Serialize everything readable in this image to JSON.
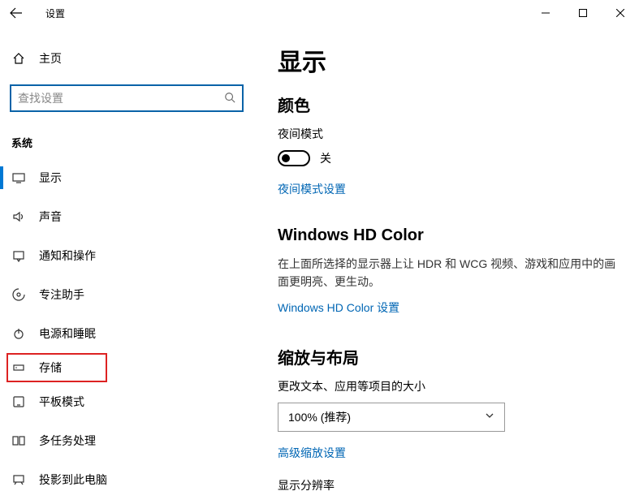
{
  "titlebar": {
    "title": "设置"
  },
  "sidebar": {
    "home": "主页",
    "search_placeholder": "查找设置",
    "section_label": "系统",
    "items": [
      {
        "label": "显示"
      },
      {
        "label": "声音"
      },
      {
        "label": "通知和操作"
      },
      {
        "label": "专注助手"
      },
      {
        "label": "电源和睡眠"
      },
      {
        "label": "存储"
      },
      {
        "label": "平板模式"
      },
      {
        "label": "多任务处理"
      },
      {
        "label": "投影到此电脑"
      }
    ]
  },
  "content": {
    "heading": "显示",
    "color_heading": "颜色",
    "night_mode_label": "夜间模式",
    "night_mode_state": "关",
    "night_mode_link": "夜间模式设置",
    "hdcolor_heading": "Windows HD Color",
    "hdcolor_desc": "在上面所选择的显示器上让 HDR 和 WCG 视频、游戏和应用中的画面更明亮、更生动。",
    "hdcolor_link": "Windows HD Color 设置",
    "scale_heading": "缩放与布局",
    "scale_label": "更改文本、应用等项目的大小",
    "scale_value": "100% (推荐)",
    "scale_link": "高级缩放设置",
    "resolution_label": "显示分辨率"
  }
}
